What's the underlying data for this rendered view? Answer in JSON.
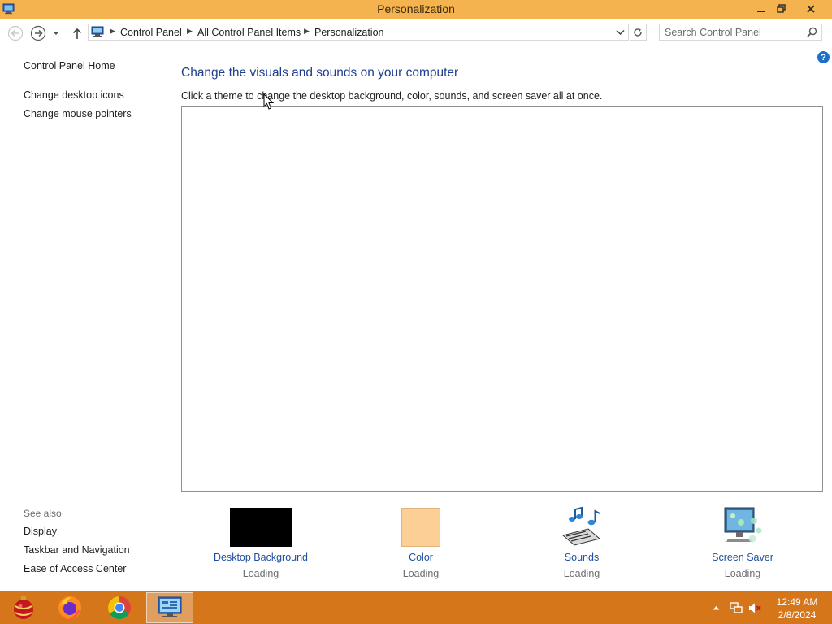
{
  "window": {
    "title": "Personalization",
    "controls": {
      "minimize": "minimize-icon",
      "maximize": "restore-icon",
      "close": "close-icon"
    }
  },
  "address_bar": {
    "breadcrumbs": [
      "Control Panel",
      "All Control Panel Items",
      "Personalization"
    ],
    "search_placeholder": "Search Control Panel"
  },
  "left_nav": {
    "home": "Control Panel Home",
    "links": [
      "Change desktop icons",
      "Change mouse pointers"
    ],
    "see_also_title": "See also",
    "see_also": [
      "Display",
      "Taskbar and Navigation",
      "Ease of Access Center"
    ]
  },
  "main": {
    "heading": "Change the visuals and sounds on your computer",
    "instruction": "Click a theme to change the desktop background, color, sounds, and screen saver all at once."
  },
  "tiles": [
    {
      "label": "Desktop Background",
      "status": "Loading",
      "icon": "desktop-background-icon",
      "color": "#000000"
    },
    {
      "label": "Color",
      "status": "Loading",
      "icon": "color-icon",
      "color": "#fccf97"
    },
    {
      "label": "Sounds",
      "status": "Loading",
      "icon": "sounds-icon"
    },
    {
      "label": "Screen Saver",
      "status": "Loading",
      "icon": "screen-saver-icon"
    }
  ],
  "taskbar": {
    "pinned": [
      "ornament-app-icon",
      "firefox-icon",
      "chrome-icon",
      "control-panel-icon"
    ],
    "tray": [
      "show-hidden-icons",
      "network-icon",
      "volume-muted-icon"
    ],
    "time": "12:49 AM",
    "date": "2/8/2024"
  },
  "colors": {
    "title_bar": "#f4b34f",
    "taskbar": "#d5761b",
    "link_blue": "#1e4f9e",
    "heading_blue": "#1e3f8f"
  }
}
